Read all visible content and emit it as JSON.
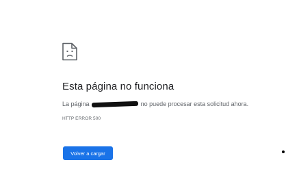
{
  "icon": "sad-page-icon",
  "error": {
    "title": "Esta página no funciona",
    "message_prefix": "La página",
    "message_suffix": "no puede procesar esta solicitud ahora.",
    "code": "HTTP ERROR 500"
  },
  "actions": {
    "reload_label": "Volver a cargar"
  },
  "colors": {
    "accent": "#1a73e8",
    "title": "#202124",
    "body_text": "#5f6368",
    "background": "#ffffff"
  }
}
